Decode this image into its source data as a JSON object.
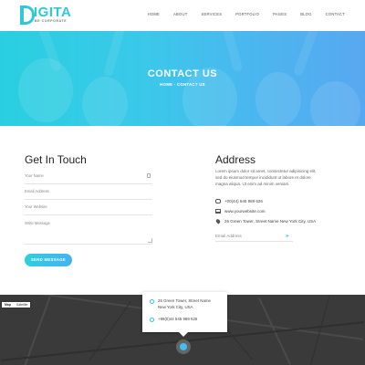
{
  "brand": {
    "name": "IGITA",
    "tagline": "BE CORPORATE"
  },
  "nav": {
    "items": [
      "HOME",
      "ABOUT",
      "SERVICES",
      "PORTFOLIO",
      "PAGES",
      "BLOG",
      "CONTACT"
    ]
  },
  "hero": {
    "title": "CONTACT US",
    "breadcrumb_home": "HOME",
    "breadcrumb_sep": " - ",
    "breadcrumb_current": "CONTACT US"
  },
  "form": {
    "title": "Get In Touch",
    "name_placeholder": "Your Name",
    "email_placeholder": "Email Address",
    "website_placeholder": "Your Website",
    "message_placeholder": "Write Message",
    "send_label": "SEND MESSAGE"
  },
  "address": {
    "title": "Address",
    "description": "Lorem ipsum dolor sit amet, consectetur adipisicing elit, sed do eiusmod tempor incididunt ut labore et dolore magna aliqua. Ut enim ad minim veniam.",
    "phone": "+00(44) 545 989 626",
    "website": "www.yourwebsite.com",
    "location": "26 Green Tower, Street Name New York City, USA",
    "email_placeholder": "Email Address"
  },
  "map": {
    "tab_map": "Map",
    "tab_satellite": "Satellite",
    "popup_address_line1": "26 Green Tower, Street Name",
    "popup_address_line2": "New York City, USA",
    "popup_phone": "+99(0)44 545 989 626"
  }
}
